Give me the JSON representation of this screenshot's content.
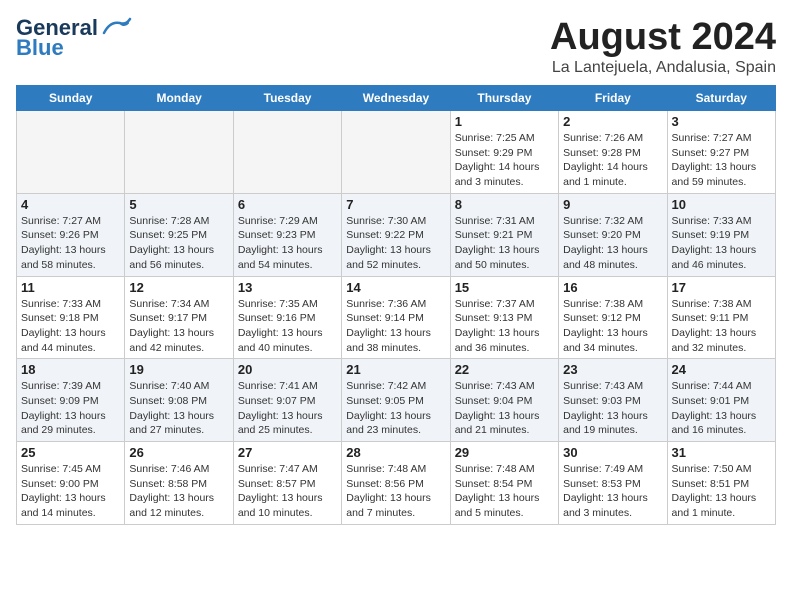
{
  "header": {
    "logo_general": "General",
    "logo_blue": "Blue",
    "month_year": "August 2024",
    "location": "La Lantejuela, Andalusia, Spain"
  },
  "days_of_week": [
    "Sunday",
    "Monday",
    "Tuesday",
    "Wednesday",
    "Thursday",
    "Friday",
    "Saturday"
  ],
  "weeks": [
    [
      {
        "day": "",
        "info": ""
      },
      {
        "day": "",
        "info": ""
      },
      {
        "day": "",
        "info": ""
      },
      {
        "day": "",
        "info": ""
      },
      {
        "day": "1",
        "info": "Sunrise: 7:25 AM\nSunset: 9:29 PM\nDaylight: 14 hours\nand 3 minutes."
      },
      {
        "day": "2",
        "info": "Sunrise: 7:26 AM\nSunset: 9:28 PM\nDaylight: 14 hours\nand 1 minute."
      },
      {
        "day": "3",
        "info": "Sunrise: 7:27 AM\nSunset: 9:27 PM\nDaylight: 13 hours\nand 59 minutes."
      }
    ],
    [
      {
        "day": "4",
        "info": "Sunrise: 7:27 AM\nSunset: 9:26 PM\nDaylight: 13 hours\nand 58 minutes."
      },
      {
        "day": "5",
        "info": "Sunrise: 7:28 AM\nSunset: 9:25 PM\nDaylight: 13 hours\nand 56 minutes."
      },
      {
        "day": "6",
        "info": "Sunrise: 7:29 AM\nSunset: 9:23 PM\nDaylight: 13 hours\nand 54 minutes."
      },
      {
        "day": "7",
        "info": "Sunrise: 7:30 AM\nSunset: 9:22 PM\nDaylight: 13 hours\nand 52 minutes."
      },
      {
        "day": "8",
        "info": "Sunrise: 7:31 AM\nSunset: 9:21 PM\nDaylight: 13 hours\nand 50 minutes."
      },
      {
        "day": "9",
        "info": "Sunrise: 7:32 AM\nSunset: 9:20 PM\nDaylight: 13 hours\nand 48 minutes."
      },
      {
        "day": "10",
        "info": "Sunrise: 7:33 AM\nSunset: 9:19 PM\nDaylight: 13 hours\nand 46 minutes."
      }
    ],
    [
      {
        "day": "11",
        "info": "Sunrise: 7:33 AM\nSunset: 9:18 PM\nDaylight: 13 hours\nand 44 minutes."
      },
      {
        "day": "12",
        "info": "Sunrise: 7:34 AM\nSunset: 9:17 PM\nDaylight: 13 hours\nand 42 minutes."
      },
      {
        "day": "13",
        "info": "Sunrise: 7:35 AM\nSunset: 9:16 PM\nDaylight: 13 hours\nand 40 minutes."
      },
      {
        "day": "14",
        "info": "Sunrise: 7:36 AM\nSunset: 9:14 PM\nDaylight: 13 hours\nand 38 minutes."
      },
      {
        "day": "15",
        "info": "Sunrise: 7:37 AM\nSunset: 9:13 PM\nDaylight: 13 hours\nand 36 minutes."
      },
      {
        "day": "16",
        "info": "Sunrise: 7:38 AM\nSunset: 9:12 PM\nDaylight: 13 hours\nand 34 minutes."
      },
      {
        "day": "17",
        "info": "Sunrise: 7:38 AM\nSunset: 9:11 PM\nDaylight: 13 hours\nand 32 minutes."
      }
    ],
    [
      {
        "day": "18",
        "info": "Sunrise: 7:39 AM\nSunset: 9:09 PM\nDaylight: 13 hours\nand 29 minutes."
      },
      {
        "day": "19",
        "info": "Sunrise: 7:40 AM\nSunset: 9:08 PM\nDaylight: 13 hours\nand 27 minutes."
      },
      {
        "day": "20",
        "info": "Sunrise: 7:41 AM\nSunset: 9:07 PM\nDaylight: 13 hours\nand 25 minutes."
      },
      {
        "day": "21",
        "info": "Sunrise: 7:42 AM\nSunset: 9:05 PM\nDaylight: 13 hours\nand 23 minutes."
      },
      {
        "day": "22",
        "info": "Sunrise: 7:43 AM\nSunset: 9:04 PM\nDaylight: 13 hours\nand 21 minutes."
      },
      {
        "day": "23",
        "info": "Sunrise: 7:43 AM\nSunset: 9:03 PM\nDaylight: 13 hours\nand 19 minutes."
      },
      {
        "day": "24",
        "info": "Sunrise: 7:44 AM\nSunset: 9:01 PM\nDaylight: 13 hours\nand 16 minutes."
      }
    ],
    [
      {
        "day": "25",
        "info": "Sunrise: 7:45 AM\nSunset: 9:00 PM\nDaylight: 13 hours\nand 14 minutes."
      },
      {
        "day": "26",
        "info": "Sunrise: 7:46 AM\nSunset: 8:58 PM\nDaylight: 13 hours\nand 12 minutes."
      },
      {
        "day": "27",
        "info": "Sunrise: 7:47 AM\nSunset: 8:57 PM\nDaylight: 13 hours\nand 10 minutes."
      },
      {
        "day": "28",
        "info": "Sunrise: 7:48 AM\nSunset: 8:56 PM\nDaylight: 13 hours\nand 7 minutes."
      },
      {
        "day": "29",
        "info": "Sunrise: 7:48 AM\nSunset: 8:54 PM\nDaylight: 13 hours\nand 5 minutes."
      },
      {
        "day": "30",
        "info": "Sunrise: 7:49 AM\nSunset: 8:53 PM\nDaylight: 13 hours\nand 3 minutes."
      },
      {
        "day": "31",
        "info": "Sunrise: 7:50 AM\nSunset: 8:51 PM\nDaylight: 13 hours\nand 1 minute."
      }
    ]
  ]
}
